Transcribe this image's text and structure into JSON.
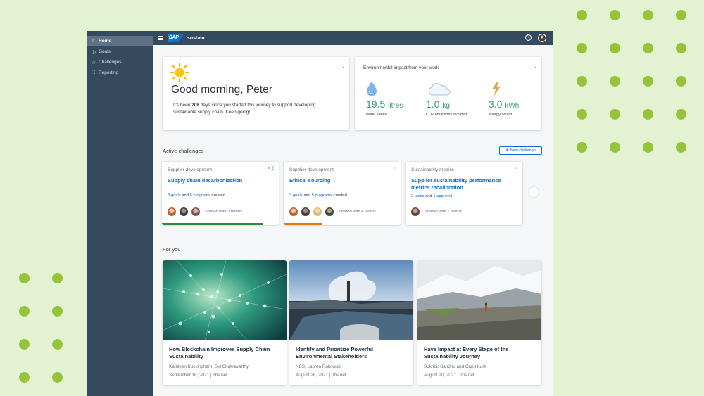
{
  "sidebar": {
    "items": [
      {
        "label": "Home",
        "icon": "home-icon",
        "active": true
      },
      {
        "label": "Goals",
        "icon": "target-icon",
        "active": false
      },
      {
        "label": "Challenges",
        "icon": "star-icon",
        "active": false
      },
      {
        "label": "Reporting",
        "icon": "chart-icon",
        "active": false
      }
    ]
  },
  "shell": {
    "logo": "SAP",
    "app_name": "sustain",
    "help_icon": "?"
  },
  "greeting": {
    "title": "Good morning, Peter",
    "text_before": "It's been ",
    "days": "208",
    "text_after": " days since you started this journey to support developing sustainable supply chain. Keep going!"
  },
  "impact": {
    "title": "Environmental impact from your work",
    "metrics": [
      {
        "value": "19.5",
        "unit": "litres",
        "label": "water saved",
        "icon": "water-drop-icon"
      },
      {
        "value": "1.0",
        "unit": "kg",
        "label": "CO2 emissions avoided",
        "icon": "cloud-icon"
      },
      {
        "value": "3.0",
        "unit": "kWh",
        "label": "energy saved",
        "icon": "lightning-icon"
      }
    ]
  },
  "challenges": {
    "section_title": "Active challenges",
    "new_button": "New challenge",
    "cards": [
      {
        "category": "Supplier development",
        "title": "Supply chain decarbonization",
        "link1": "3 goals",
        "mid": " and ",
        "link2": "5 programs",
        "suffix": " created",
        "share": "Shared with 3 teams",
        "comment_count": "2",
        "progress": 0.87,
        "progress_color": "#2b8a3e"
      },
      {
        "category": "Supplier development",
        "title": "Ethical sourcing",
        "link1": "3 goals",
        "mid": " and ",
        "link2": "5 programs",
        "suffix": " created",
        "share": "Shared with 4 teams",
        "comment_count": "",
        "progress": 0.33,
        "progress_color": "#e9730c"
      },
      {
        "category": "Sustainability metrics",
        "title": "Supplier sustainability performance metrics recalibration",
        "link1": "2 tasks",
        "mid": " and ",
        "link2": "1 approval",
        "suffix": "",
        "share": "Shared with 1 teams",
        "comment_count": "",
        "progress": 0,
        "progress_color": "#0a6ed1"
      }
    ]
  },
  "for_you": {
    "section_title": "For you",
    "articles": [
      {
        "title": "How Blockchain Improves Supply Chain Sustainability",
        "authors": "Kathleen Buckingham, Sid Chakravarthy",
        "date": "September 18, 2021 | nbs.net"
      },
      {
        "title": "Identify and Prioritize Powerful Environmental Stakeholders",
        "authors": "NBS, Lauren Rakowski",
        "date": "August 26, 2021 | nbs.net"
      },
      {
        "title": "Have Impact at Every Stage of the Sustainability Journey",
        "authors": "Sukhbir Sandhu and Carol Kulik",
        "date": "August 20, 2021 | nbs.net"
      }
    ]
  },
  "colors": {
    "accent": "#0a6ed1",
    "shell": "#354a5f",
    "metric": "#3b9b7a",
    "background": "#e3f2d0",
    "dots": "#95c43a"
  }
}
